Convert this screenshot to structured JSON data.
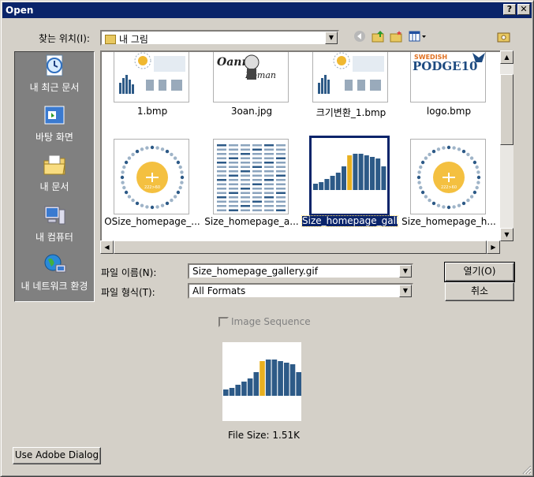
{
  "window": {
    "title": "Open"
  },
  "lookin": {
    "label": "찾는 위치(I):",
    "value": "내 그림"
  },
  "places": [
    {
      "label": "내 최근 문서",
      "icon": "recent-documents-icon"
    },
    {
      "label": "바탕 화면",
      "icon": "desktop-icon"
    },
    {
      "label": "내 문서",
      "icon": "my-documents-icon"
    },
    {
      "label": "내 컴퓨터",
      "icon": "my-computer-icon"
    },
    {
      "label": "내 네트워크 환경",
      "icon": "network-places-icon"
    }
  ],
  "files": [
    {
      "name": "1.bmp",
      "thumb": "chart-thumbnail"
    },
    {
      "name": "3oan.jpg",
      "thumb": "logo-thumbnail"
    },
    {
      "name": "크기변환_1.bmp",
      "thumb": "chart-thumbnail"
    },
    {
      "name": "logo.bmp",
      "thumb": "podge-logo-thumbnail"
    },
    {
      "name": "OSize_homepage_...",
      "thumb": "radial-thumbnail"
    },
    {
      "name": "Size_homepage_a...",
      "thumb": "table-thumbnail"
    },
    {
      "name": "Size_homepage_gallery.gif",
      "thumb": "bar-thumbnail",
      "selected": true
    },
    {
      "name": "Size_homepage_h...",
      "thumb": "radial-thumbnail"
    }
  ],
  "thumb_text": {
    "podge_top": "SWEDISH",
    "podge_main": "PODGE10",
    "oan_top": "Oanny",
    "oan_bottom": "Roman",
    "radial_label": "222>60"
  },
  "filename": {
    "label": "파일 이름(N):",
    "value": "Size_homepage_gallery.gif"
  },
  "filetype": {
    "label": "파일 형식(T):",
    "value": "All Formats"
  },
  "buttons": {
    "open": "열기(O)",
    "cancel": "취소",
    "adobe": "Use Adobe Dialog"
  },
  "image_sequence": {
    "label": "Image Sequence",
    "checked": false
  },
  "preview": {
    "filesize": "File Size: 1.51K"
  },
  "colors": {
    "title_bar": "#0a246a",
    "bar_blue": "#2d5a87",
    "bar_gold": "#e8b020"
  }
}
